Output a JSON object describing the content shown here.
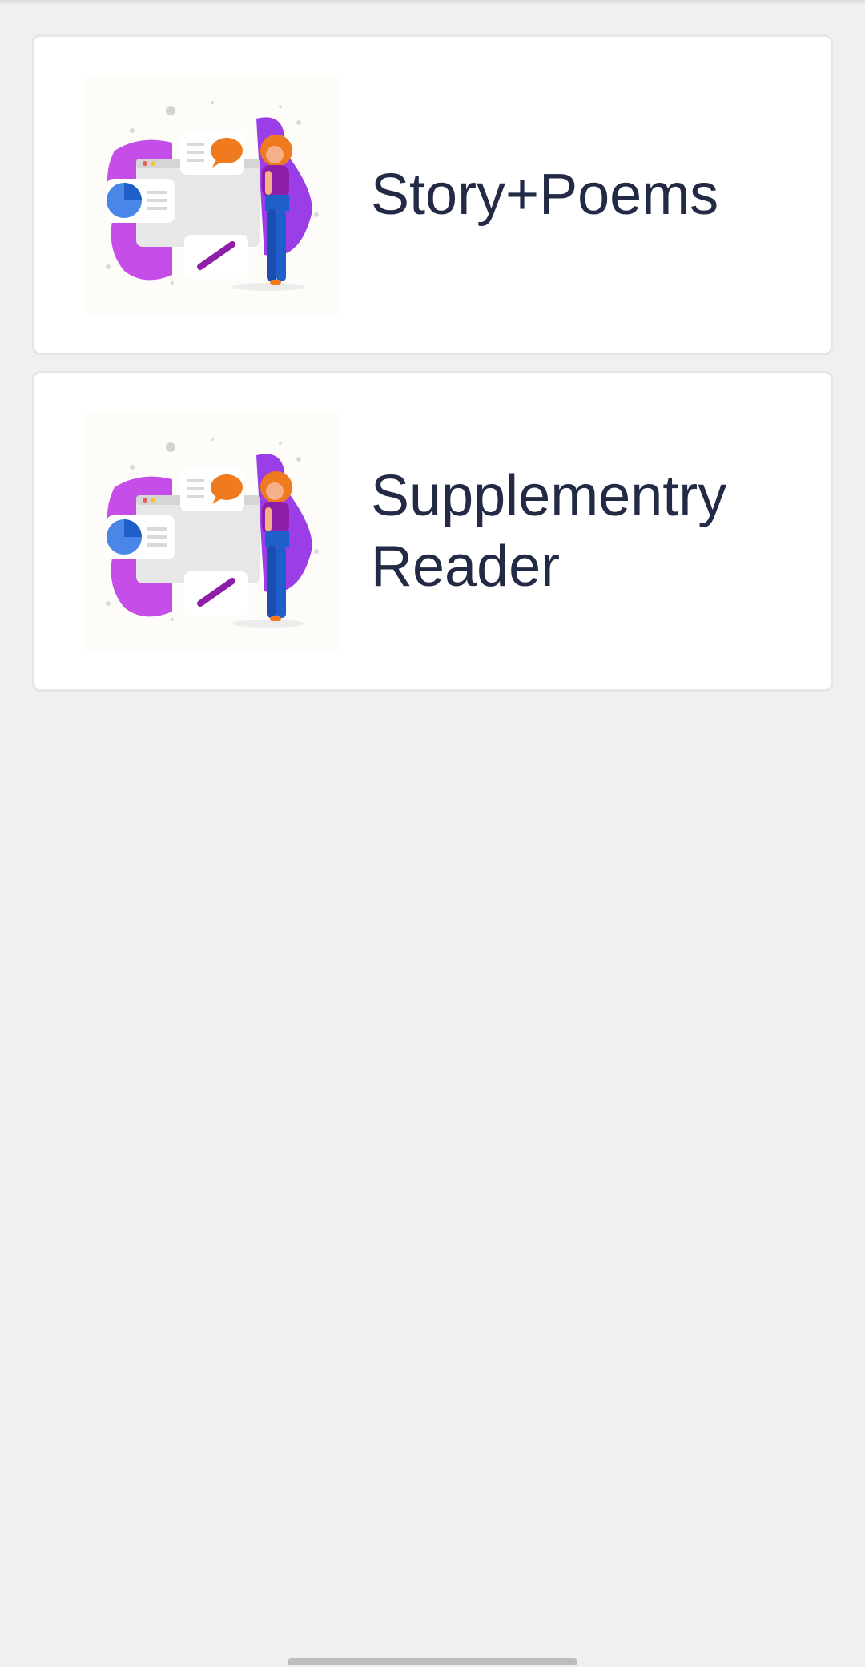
{
  "items": [
    {
      "title": "Story+Poems",
      "illustration": "person-with-documents-illustration"
    },
    {
      "title": "Supplementry Reader",
      "illustration": "person-with-documents-illustration"
    }
  ],
  "colors": {
    "background": "#f0f0f1",
    "card": "#ffffff",
    "card_border": "#e4e5ea",
    "title_text": "#222a45",
    "illustration_purple": "#c54de8",
    "illustration_orange": "#f07a1e",
    "illustration_blue": "#1f5fc9",
    "home_indicator": "#bdbdbf"
  }
}
